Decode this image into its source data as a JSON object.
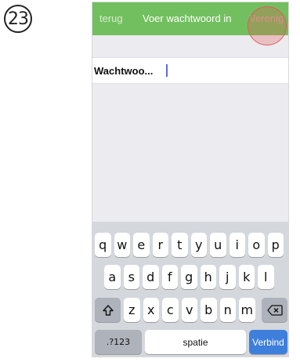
{
  "step_number": "23",
  "navbar": {
    "back_label": "terug",
    "title": "Voer wachtwoord in",
    "action_label": "Verenig"
  },
  "form": {
    "field_label": "Wachtwoo...",
    "field_value": ""
  },
  "keyboard": {
    "row1": [
      "q",
      "w",
      "e",
      "r",
      "t",
      "y",
      "u",
      "i",
      "o",
      "p"
    ],
    "row2": [
      "a",
      "s",
      "d",
      "f",
      "g",
      "h",
      "j",
      "k",
      "l"
    ],
    "row3": [
      "z",
      "x",
      "c",
      "v",
      "b",
      "n",
      "m"
    ],
    "shift_icon": "shift-icon",
    "backspace_icon": "backspace-icon",
    "numbers_label": ".?123",
    "space_label": "spatie",
    "return_label": "Verbind"
  },
  "colors": {
    "navbar": "#72bf5f",
    "return_key": "#3f7fdc",
    "highlight": "#e15b5b"
  }
}
